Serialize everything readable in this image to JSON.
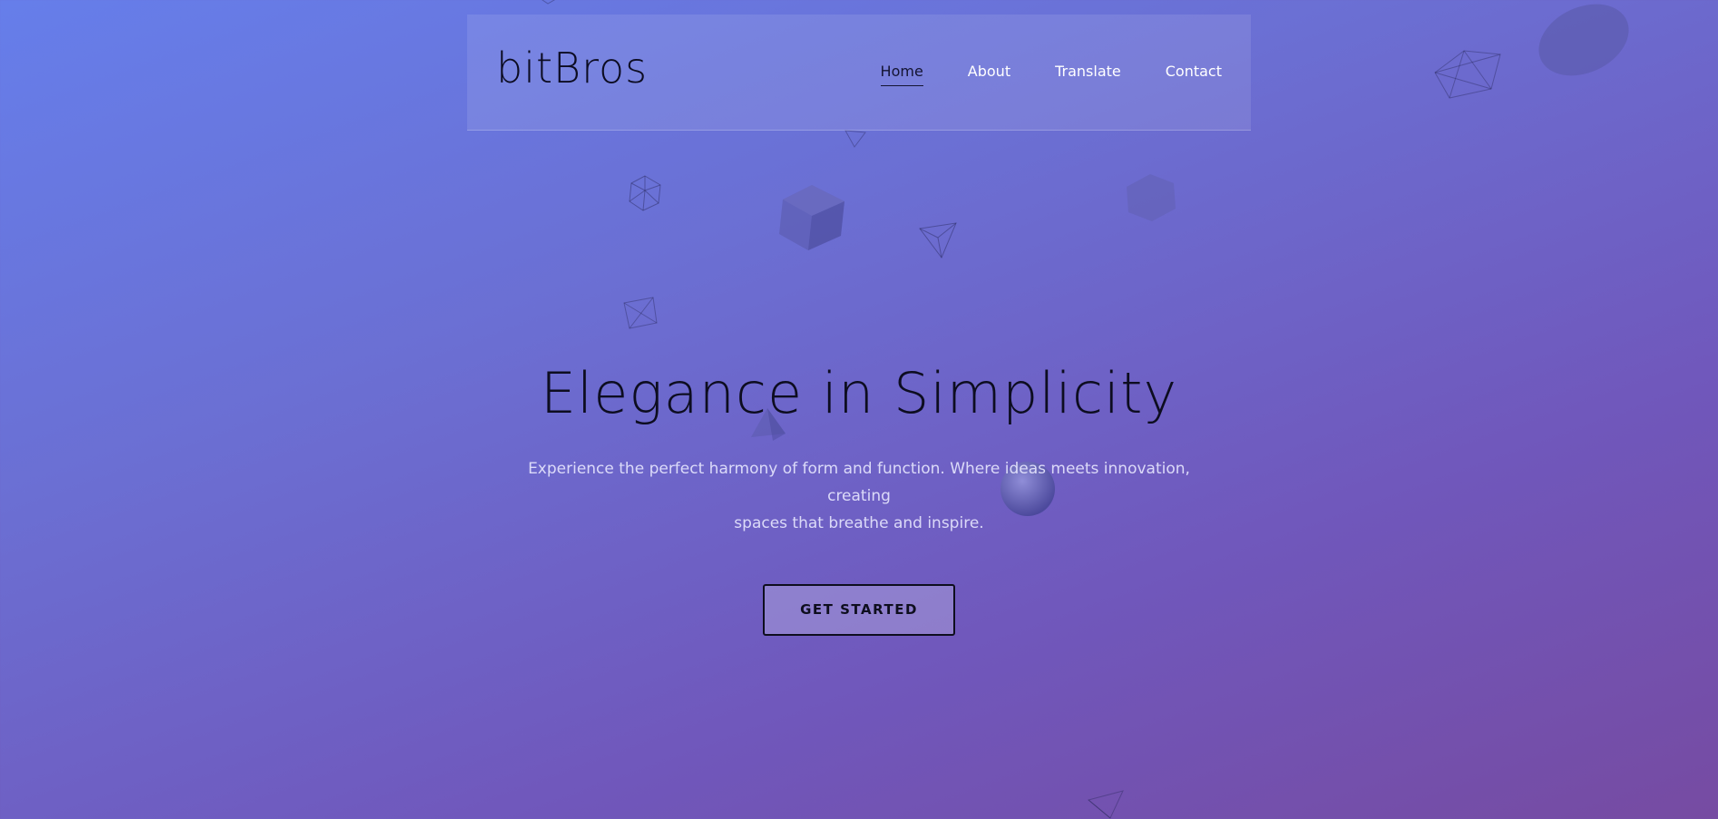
{
  "header": {
    "logo": "bitBros",
    "nav": [
      {
        "label": "Home",
        "active": true
      },
      {
        "label": "About",
        "active": false
      },
      {
        "label": "Translate",
        "active": false
      },
      {
        "label": "Contact",
        "active": false
      }
    ]
  },
  "hero": {
    "title": "Elegance in Simplicity",
    "subtitle_line1": "Experience the perfect harmony of form and function. Where ideas meets innovation, creating",
    "subtitle_line2": "spaces that breathe and inspire.",
    "cta_label": "GET STARTED"
  },
  "colors": {
    "gradient_start": "#667eea",
    "gradient_end": "#764ba2",
    "text_dark": "#0d0d20"
  }
}
